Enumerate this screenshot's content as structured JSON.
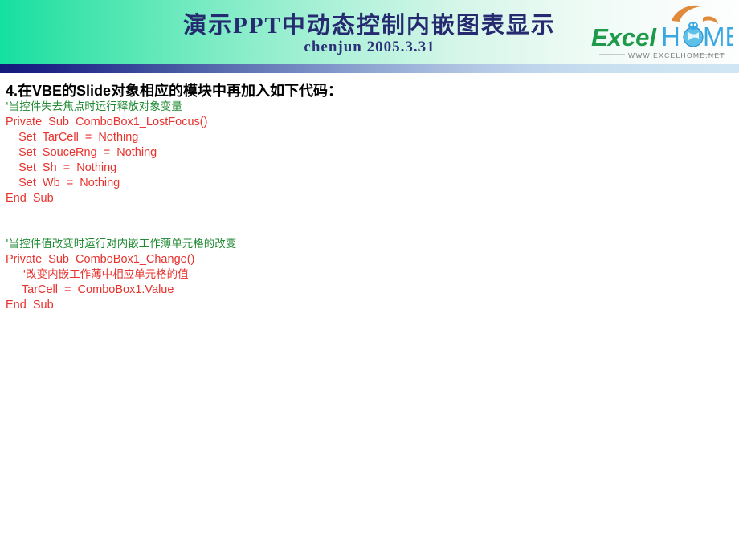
{
  "slide": {
    "header": {
      "title": "演示PPT中动态控制内嵌图表显示",
      "subtitle": "chenjun   2005.3.31",
      "title_color": "#262a70",
      "gradient_start": "#14e0a0",
      "gradient_end": "#fdfefe",
      "divider_start": "#141a7a",
      "divider_end": "#d0e6f5"
    },
    "logo": {
      "word_excel": "Excel",
      "word_h": "H",
      "word_me": "ME",
      "url": "WWW.EXCELHOME.NET",
      "excel_color": "#1f9a4a",
      "home_color": "#3aa8e0",
      "swoosh_color": "#e08a3c",
      "globe_color": "#3aa8e0"
    },
    "body": {
      "heading": "4.在VBE的Slide对象相应的模块中再加入如下代码：",
      "code_lines": [
        {
          "text": "'当控件失去焦点时运行释放对象变量",
          "color": "green",
          "cjk": true
        },
        {
          "text": "Private  Sub  ComboBox1_LostFocus()",
          "color": "red",
          "cjk": false
        },
        {
          "text": "    Set  TarCell  =  Nothing",
          "color": "red",
          "cjk": false
        },
        {
          "text": "    Set  SouceRng  =  Nothing",
          "color": "red",
          "cjk": false
        },
        {
          "text": "    Set  Sh  =  Nothing",
          "color": "red",
          "cjk": false
        },
        {
          "text": "    Set  Wb  =  Nothing",
          "color": "red",
          "cjk": false
        },
        {
          "text": "End  Sub",
          "color": "red",
          "cjk": false
        },
        {
          "text": "",
          "color": "red",
          "cjk": false
        },
        {
          "text": "",
          "color": "red",
          "cjk": false
        },
        {
          "text": "'当控件值改变时运行对内嵌工作薄单元格的改变",
          "color": "green",
          "cjk": true
        },
        {
          "text": "Private  Sub  ComboBox1_Change()",
          "color": "red",
          "cjk": false
        },
        {
          "text": "     '改变内嵌工作薄中相应单元格的值",
          "color": "red",
          "cjk": true
        },
        {
          "text": "     TarCell  =  ComboBox1.Value",
          "color": "red",
          "cjk": false
        },
        {
          "text": "End  Sub",
          "color": "red",
          "cjk": false
        }
      ],
      "comment_color": "#1f8a32",
      "code_color": "#e8322d",
      "heading_color": "#000000"
    }
  }
}
